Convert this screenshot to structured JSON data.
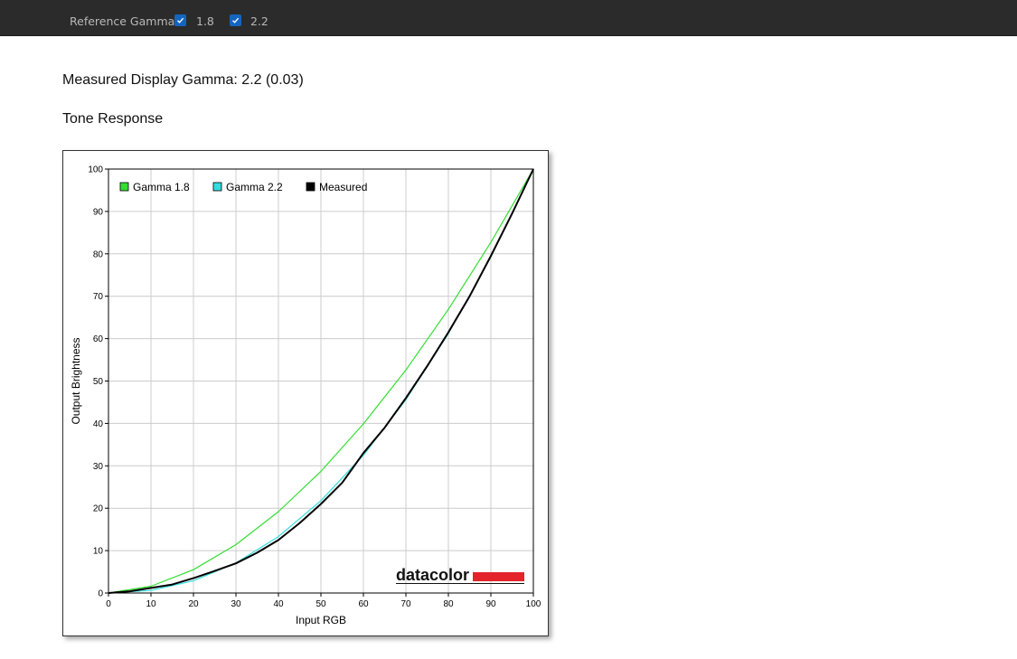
{
  "toolbar": {
    "reference_label": "Reference Gamma:",
    "options": [
      {
        "label": "1.8",
        "checked": true
      },
      {
        "label": "2.2",
        "checked": true
      }
    ]
  },
  "summary": {
    "measured_text": "Measured Display Gamma: 2.2 (0.03)",
    "section_title": "Tone Response"
  },
  "logo": {
    "text": "datacolor",
    "bar_color": "#e3242b"
  },
  "chart_data": {
    "type": "line",
    "xlabel": "Input RGB",
    "ylabel": "Output Brightness",
    "xlim": [
      0,
      100
    ],
    "ylim": [
      0,
      100
    ],
    "xticks": [
      0,
      10,
      20,
      30,
      40,
      50,
      60,
      70,
      80,
      90,
      100
    ],
    "yticks": [
      0,
      10,
      20,
      30,
      40,
      50,
      60,
      70,
      80,
      90,
      100
    ],
    "grid": true,
    "legend_position": "top-left",
    "series": [
      {
        "name": "Gamma 1.8",
        "color": "#33dd33",
        "x": [
          0,
          10,
          20,
          30,
          40,
          50,
          60,
          70,
          80,
          90,
          100
        ],
        "y": [
          0,
          1.6,
          5.5,
          11.4,
          19.2,
          28.7,
          39.9,
          52.6,
          66.9,
          82.7,
          100
        ]
      },
      {
        "name": "Gamma 2.2",
        "color": "#33dddd",
        "x": [
          0,
          10,
          20,
          30,
          40,
          50,
          60,
          70,
          80,
          90,
          100
        ],
        "y": [
          0,
          0.6,
          2.9,
          7.1,
          13.3,
          21.8,
          32.5,
          45.6,
          61.2,
          79.3,
          100
        ]
      },
      {
        "name": "Measured",
        "color": "#000000",
        "x": [
          0,
          5,
          10,
          15,
          20,
          25,
          30,
          35,
          40,
          45,
          50,
          55,
          60,
          65,
          70,
          75,
          80,
          85,
          90,
          95,
          100
        ],
        "y": [
          0,
          0.4,
          1.2,
          2.0,
          3.5,
          5.2,
          7.0,
          9.5,
          12.5,
          16.5,
          21.0,
          26.0,
          33.0,
          39.0,
          46.0,
          53.5,
          61.5,
          70.0,
          79.5,
          89.5,
          100
        ]
      }
    ]
  }
}
